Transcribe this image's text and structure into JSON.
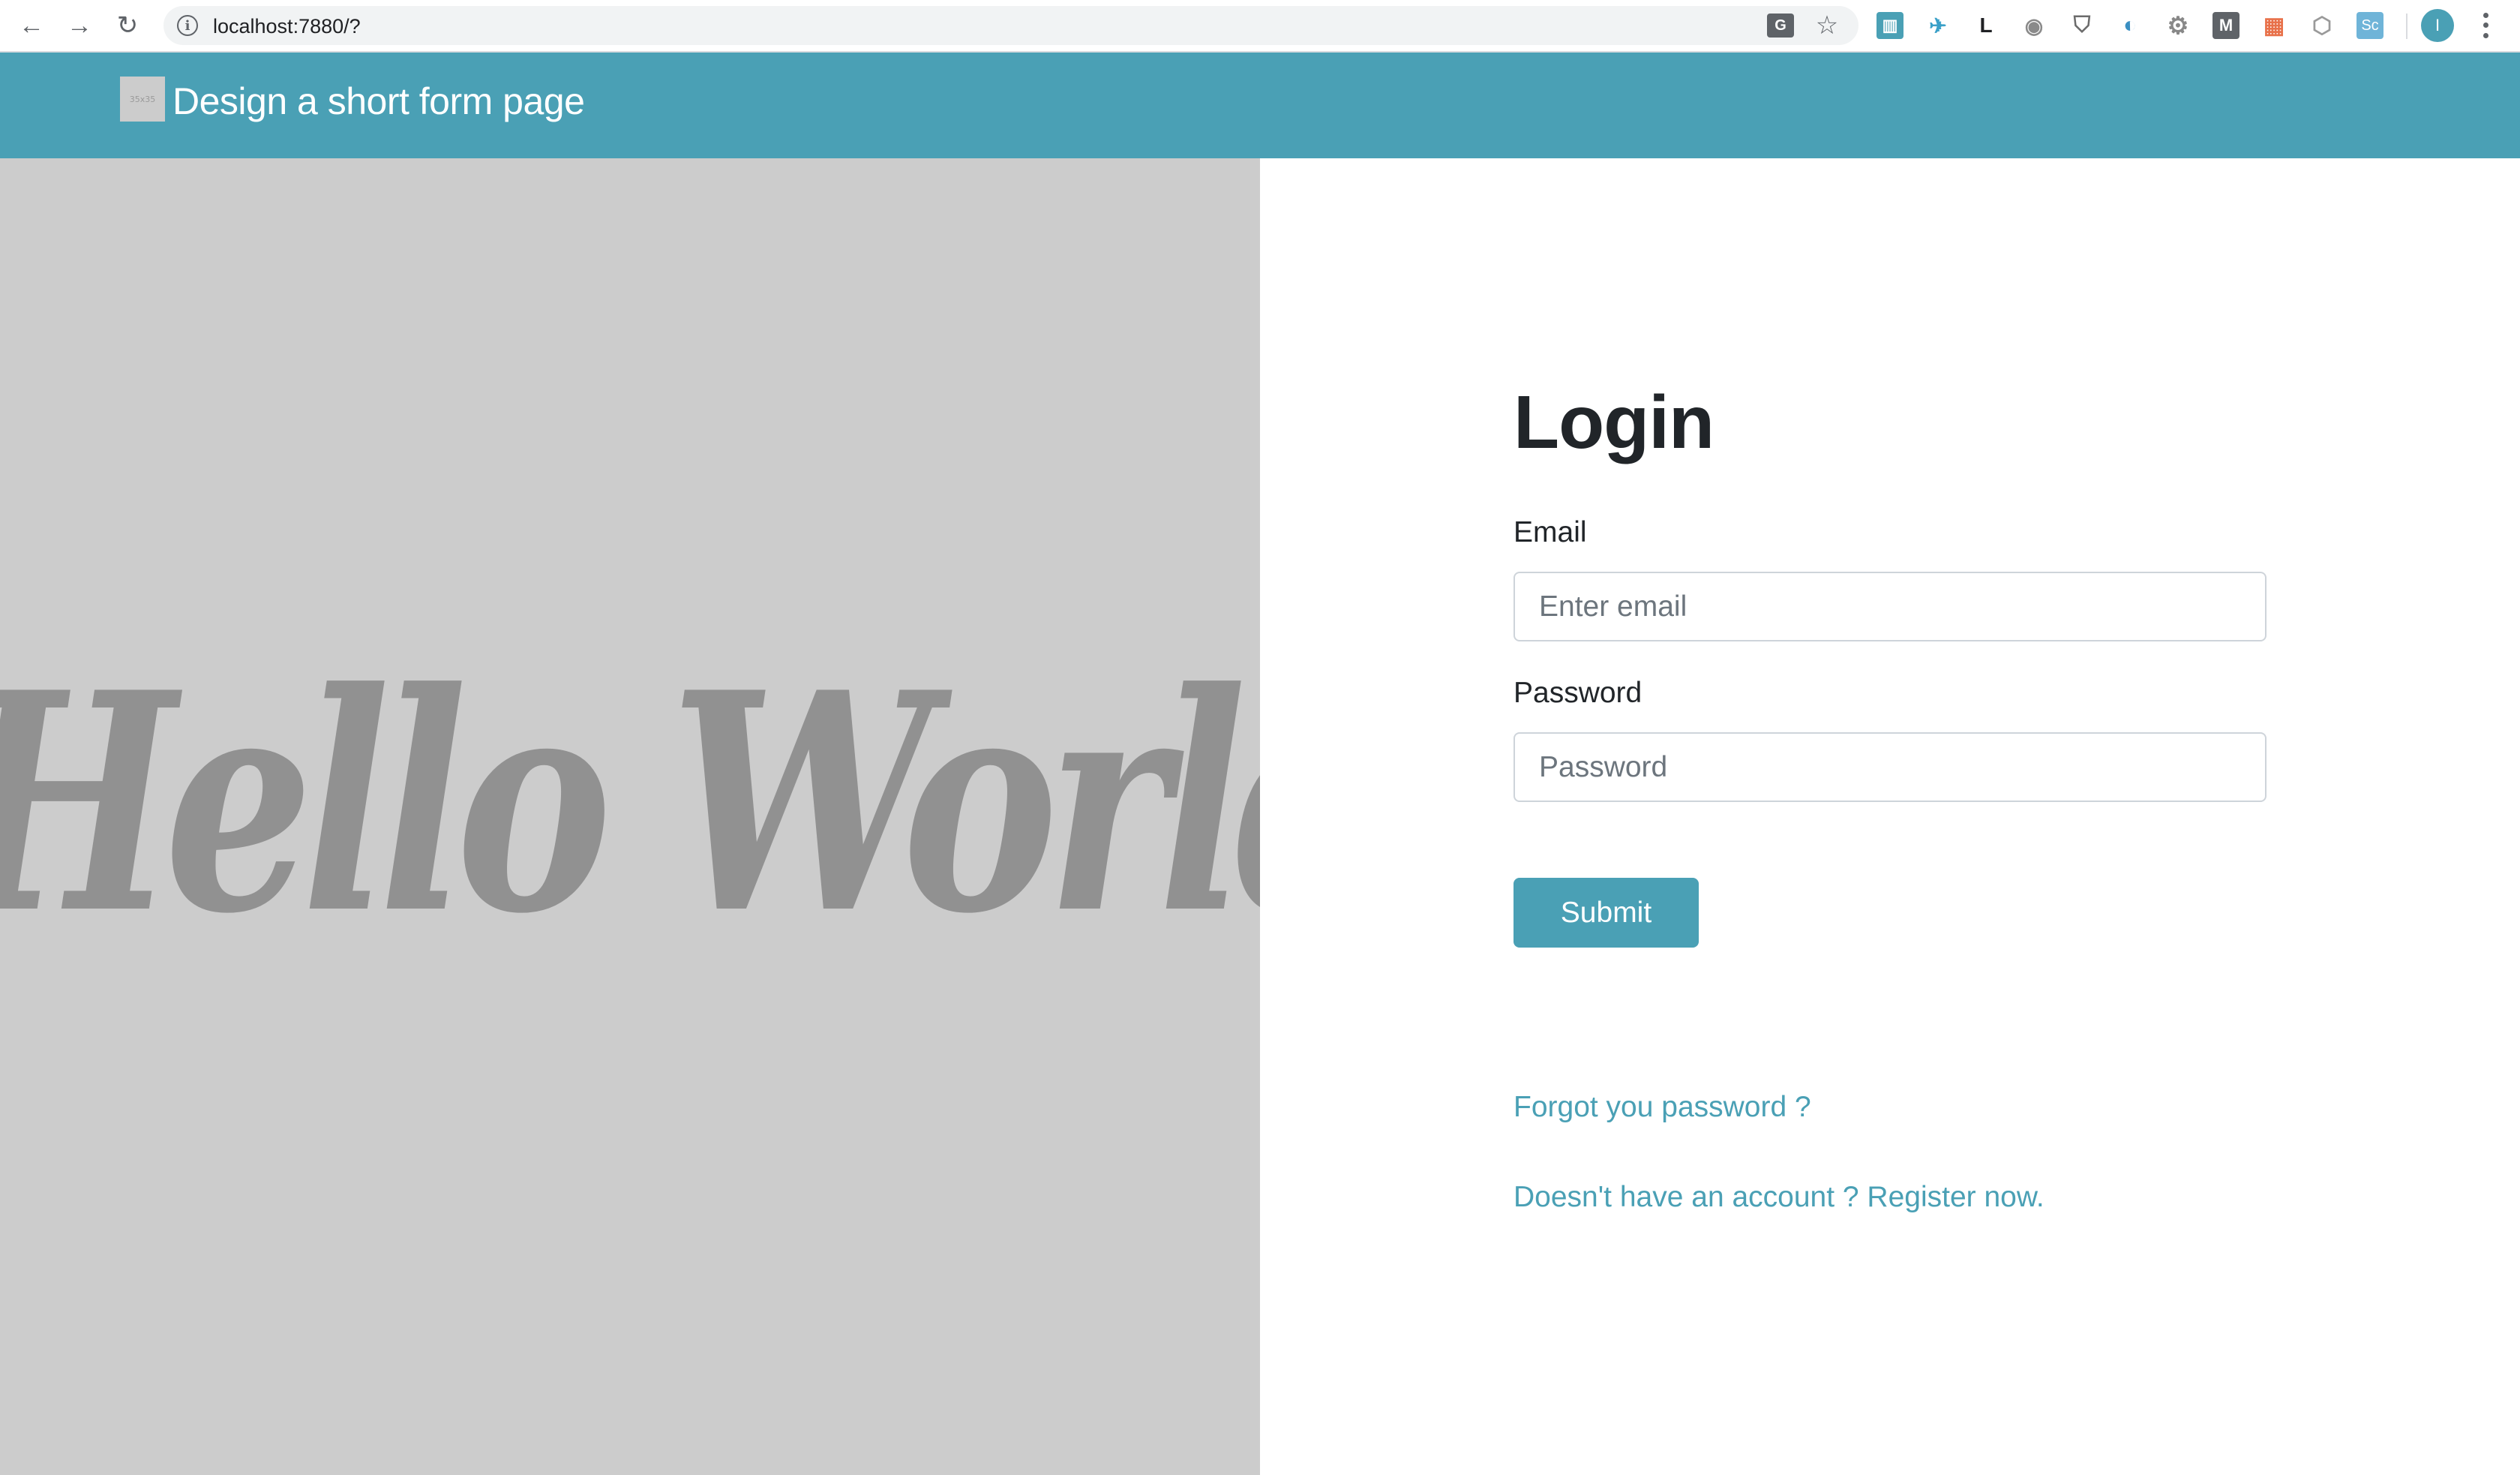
{
  "browser": {
    "url": "localhost:7880/?",
    "nav": {
      "back_glyph": "←",
      "forward_glyph": "→",
      "reload_glyph": "↻",
      "info_glyph": "i"
    },
    "omnibox_icons": [
      {
        "name": "translate-icon",
        "glyph": "G",
        "color": "#5f6368"
      },
      {
        "name": "bookmark-star-icon",
        "glyph": "☆",
        "color": "#5f6368"
      }
    ],
    "extensions": [
      {
        "name": "trello-extension-icon",
        "glyph": "▥",
        "color": "#4aa0b5"
      },
      {
        "name": "runner-extension-icon",
        "glyph": "✈",
        "color": "#3aa0c8"
      },
      {
        "name": "l-extension-icon",
        "glyph": "L",
        "color": "#202124"
      },
      {
        "name": "camera-extension-icon",
        "glyph": "◉",
        "color": "#8a8a8a"
      },
      {
        "name": "ublock-extension-icon",
        "glyph": "⛉",
        "color": "#6b6b6b"
      },
      {
        "name": "lock-extension-icon",
        "glyph": "◐",
        "color": "#3a8fc2"
      },
      {
        "name": "gear-extension-icon",
        "glyph": "⚙",
        "color": "#888888"
      },
      {
        "name": "medium-extension-icon",
        "glyph": "M",
        "color": "#5f6368"
      },
      {
        "name": "layout-extension-icon",
        "glyph": "▦",
        "color": "#e8714a"
      },
      {
        "name": "nodejs-extension-icon",
        "glyph": "⬡",
        "color": "#9a9a9a"
      },
      {
        "name": "sc-extension-icon",
        "glyph": "Sc",
        "color": "#6fb4d8"
      }
    ],
    "profile_initial": "I"
  },
  "header": {
    "logo_placeholder": "35x35",
    "title": "Design a short form page",
    "color": "#4aa0b5"
  },
  "hero": {
    "text": "Hello World",
    "background": "#cccccc",
    "text_color": "#919191"
  },
  "login": {
    "title": "Login",
    "email": {
      "label": "Email",
      "value": "",
      "placeholder": "Enter email"
    },
    "password": {
      "label": "Password",
      "value": "",
      "placeholder": "Password"
    },
    "submit_label": "Submit",
    "forgot_link": "Forgot you password ?",
    "register_link": "Doesn't have an account ? Register now."
  }
}
